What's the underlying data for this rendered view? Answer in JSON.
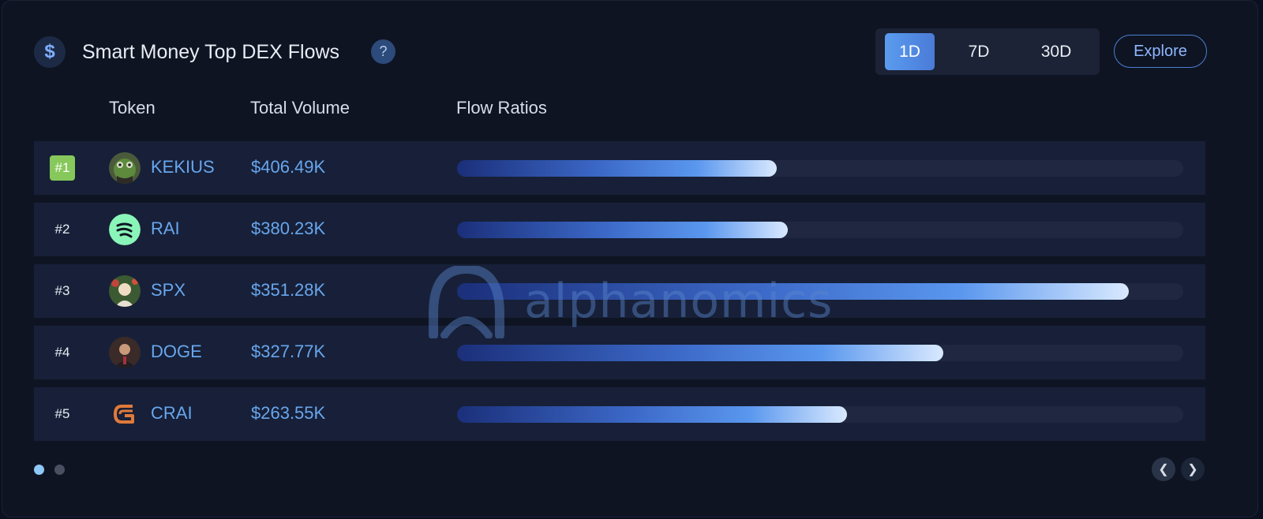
{
  "header": {
    "icon": "dollar-icon",
    "icon_glyph": "$",
    "title": "Smart Money Top DEX Flows",
    "help_glyph": "?"
  },
  "range": {
    "options": [
      "1D",
      "7D",
      "30D"
    ],
    "selected": "1D"
  },
  "explore_label": "Explore",
  "columns": {
    "token": "Token",
    "volume": "Total Volume",
    "flow": "Flow Ratios"
  },
  "rows": [
    {
      "rank": "#1",
      "symbol": "KEKIUS",
      "volume": "$406.49K",
      "flow_ratio": 0.44,
      "avatar": "frog-avatar"
    },
    {
      "rank": "#2",
      "symbol": "RAI",
      "volume": "$380.23K",
      "flow_ratio": 0.455,
      "avatar": "rai-logo"
    },
    {
      "rank": "#3",
      "symbol": "SPX",
      "volume": "$351.28K",
      "flow_ratio": 0.925,
      "avatar": "spx-avatar"
    },
    {
      "rank": "#4",
      "symbol": "DOGE",
      "volume": "$327.77K",
      "flow_ratio": 0.67,
      "avatar": "doge-avatar"
    },
    {
      "rank": "#5",
      "symbol": "CRAI",
      "volume": "$263.55K",
      "flow_ratio": 0.537,
      "avatar": "crai-logo"
    }
  ],
  "watermark": "alphanomics",
  "pagination": {
    "pages": 2,
    "current": 1
  },
  "colors": {
    "accent": "#5a9cf0",
    "text_link": "#68a6ee",
    "rank_one_badge": "#86c85b",
    "rai_logo_bg": "#8af5b8",
    "crai_logo": "#e07a3a"
  }
}
